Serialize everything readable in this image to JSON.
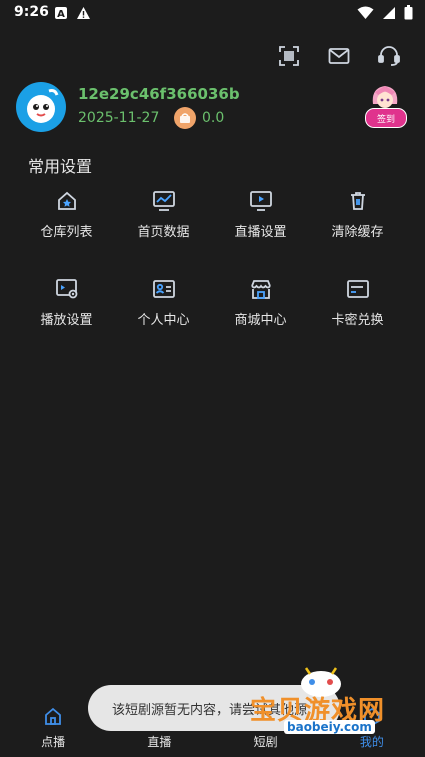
{
  "status_bar": {
    "time": "9:26",
    "left_icons": [
      "a-box-icon",
      "warning-icon"
    ],
    "right_icons": [
      "wifi-icon",
      "signal-icon",
      "battery-icon"
    ]
  },
  "top_actions": [
    "scan-icon",
    "mail-icon",
    "headset-icon"
  ],
  "profile": {
    "user_id": "12e29c46f366036b",
    "date": "2025-11-27",
    "coin_value": "0.0",
    "badge_label": "签到"
  },
  "section_title": "常用设置",
  "settings_grid": [
    {
      "label": "仓库列表",
      "icon": "house-icon"
    },
    {
      "label": "首页数据",
      "icon": "chart-monitor-icon"
    },
    {
      "label": "直播设置",
      "icon": "tv-play-icon"
    },
    {
      "label": "清除缓存",
      "icon": "trash-icon"
    },
    {
      "label": "播放设置",
      "icon": "player-settings-icon"
    },
    {
      "label": "个人中心",
      "icon": "id-card-icon"
    },
    {
      "label": "商城中心",
      "icon": "store-icon"
    },
    {
      "label": "卡密兑换",
      "icon": "card-icon"
    }
  ],
  "bottom_nav": [
    {
      "label": "点播",
      "icon": "home-icon",
      "active": false
    },
    {
      "label": "直播",
      "icon": "live-icon",
      "active": false
    },
    {
      "label": "短剧",
      "icon": "short-drama-icon",
      "active": false
    },
    {
      "label": "我的",
      "icon": "profile-icon",
      "active": true
    }
  ],
  "toast": "该短剧源暂无内容，请尝试其他源",
  "watermark": {
    "text": "宝贝游戏网",
    "url": "baobeiy.com"
  },
  "colors": {
    "background": "#1c1c1c",
    "accent_green": "#6bc06d",
    "accent_blue": "#3f8ee8",
    "icon_blue": "#4aa3ff",
    "badge_pink": "#e0338d"
  }
}
